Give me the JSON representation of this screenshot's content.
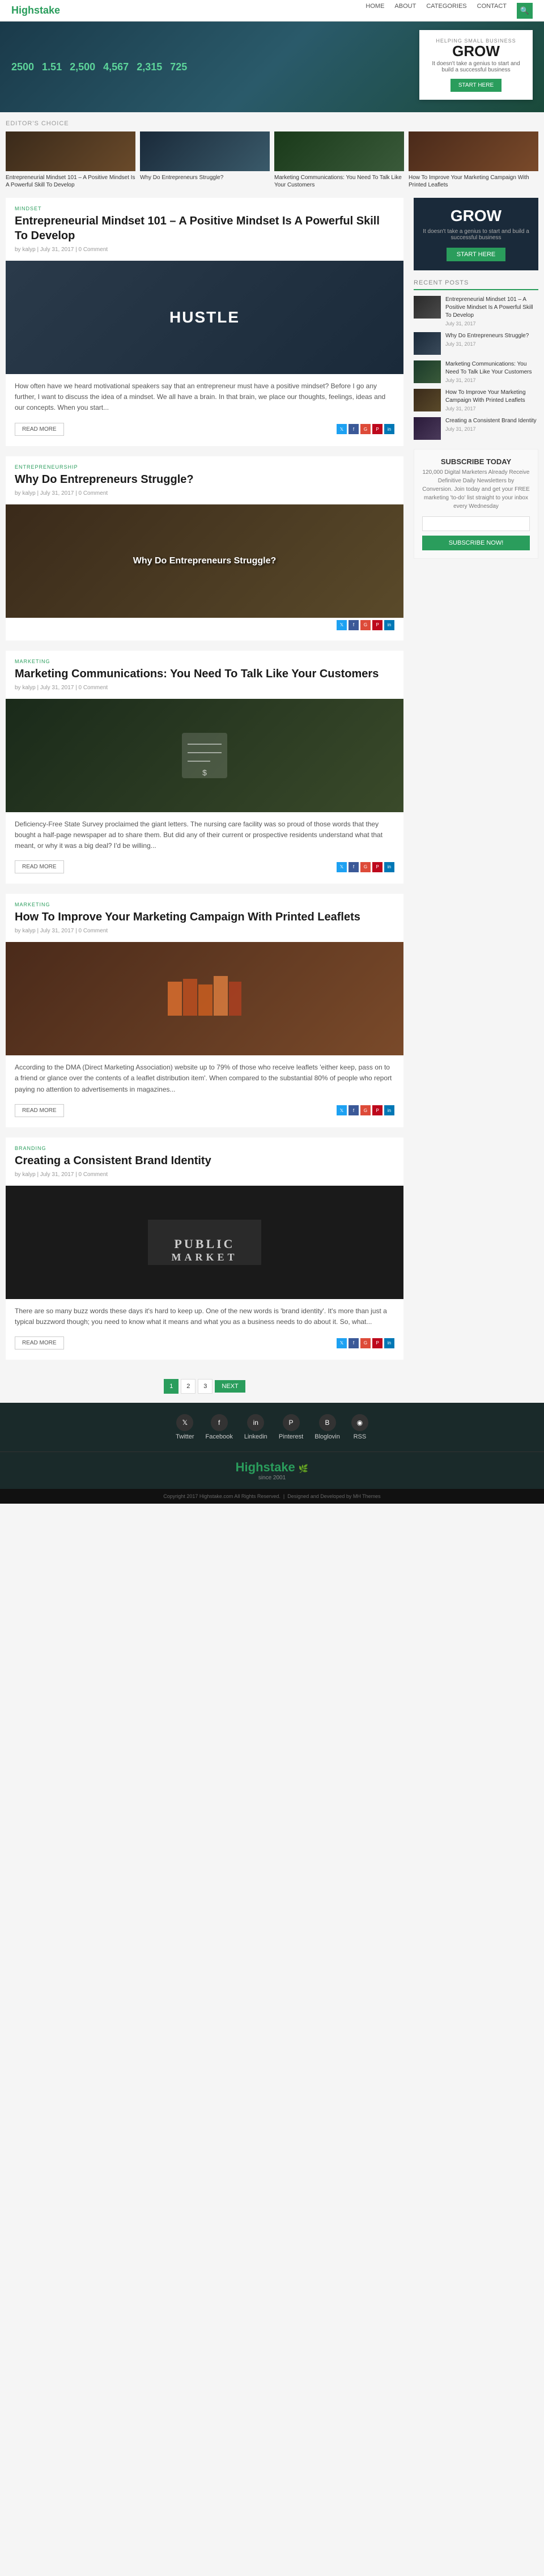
{
  "nav": {
    "brand": "Highstake",
    "links": [
      "Home",
      "About",
      "Categories",
      "Contact"
    ],
    "search_placeholder": "Search..."
  },
  "hero": {
    "stats": [
      {
        "label": "",
        "value": "2500"
      },
      {
        "label": "",
        "value": "1.51"
      },
      {
        "label": "",
        "value": "2,500"
      },
      {
        "label": "",
        "value": "4,567"
      },
      {
        "label": "",
        "value": "2,315"
      },
      {
        "label": "",
        "value": "725"
      }
    ],
    "cta": {
      "small": "HELPING SMALL BUSINESS",
      "title": "GROW",
      "sub": "It doesn't take a genius to start and build a successful business",
      "btn": "START HERE"
    }
  },
  "editors_choice": {
    "label": "EDITOR'S CHOICE",
    "cards": [
      {
        "id": "card-1",
        "title": "Entrepreneurial Mindset 101 – A Positive Mindset Is A Powerful Skill To Develop",
        "thumb_class": "thumb-1"
      },
      {
        "id": "card-2",
        "title": "Why Do Entrepreneurs Struggle?",
        "thumb_class": "thumb-2"
      },
      {
        "id": "card-3",
        "title": "Marketing Communications: You Need To Talk Like Your Customers",
        "thumb_class": "thumb-3"
      },
      {
        "id": "card-4",
        "title": "How To Improve Your Marketing Campaign With Printed Leaflets",
        "thumb_class": "thumb-4"
      }
    ]
  },
  "posts": [
    {
      "id": "post-1",
      "category": "MINDSET",
      "title": "Entrepreneurial Mindset 101 – A Positive Mindset Is A Powerful Skill To Develop",
      "meta": "by kalyp   |   July 31, 2017   |   0 Comment",
      "image_class": "hustle",
      "image_label": "HUSTLE",
      "excerpt": "How often have we heard motivational speakers say that an entrepreneur must have a positive mindset? Before I go any further, I want to discuss the idea of a mindset. We all have a brain. In that brain, we place our thoughts, feelings, ideas and our concepts. When you start...",
      "read_more": "READ MORE"
    },
    {
      "id": "post-2",
      "category": "ENTREPRENEURSHIP",
      "title": "Why Do Entrepreneurs Struggle?",
      "meta": "by kalyp   |   July 31, 2017   |   0 Comment",
      "image_class": "struggle",
      "image_label": "Why Do Entrepreneurs Struggle?",
      "excerpt": "",
      "read_more": ""
    },
    {
      "id": "post-3",
      "category": "MARKETING",
      "title": "Marketing Communications: You Need To Talk Like Your Customers",
      "meta": "by kalyp   |   July 31, 2017   |   0 Comment",
      "image_class": "marketing",
      "image_label": "",
      "excerpt": "Deficiency-Free State Survey proclaimed the giant letters. The nursing care facility was so proud of those words that they bought a half-page newspaper ad to share them. But did any of their current or prospective residents understand what that meant, or why it was a big deal? I'd be willing...",
      "read_more": "READ MORE"
    },
    {
      "id": "post-4",
      "category": "MARKETING",
      "title": "How To Improve Your Marketing Campaign With Printed Leaflets",
      "meta": "by kalyp   |   July 31, 2017   |   0 Comment",
      "image_class": "leaflets",
      "image_label": "",
      "excerpt": "According to the DMA (Direct Marketing Association) website up to 79% of those who receive leaflets 'either keep, pass on to a friend or glance over the contents of a leaflet distribution item'. When compared to the substantial 80% of people who report paying no attention to advertisements in magazines...",
      "read_more": "READ MORE"
    },
    {
      "id": "post-5",
      "category": "BRANDING",
      "title": "Creating a Consistent Brand Identity",
      "meta": "by kalyp   |   July 31, 2017   |   0 Comment",
      "image_class": "brand",
      "image_label": "PUBLIC MARKET",
      "excerpt": "There are so many buzz words these days it's hard to keep up. One of the new words is 'brand identity'. It's more than just a typical buzzword though; you need to know what it means and what you as a business needs to do about it. So, what...",
      "read_more": "READ MORE"
    }
  ],
  "sidebar": {
    "grow_box": {
      "title": "GROW",
      "sub": "It doesn't take a genius to start and build a successful business",
      "btn": "START HERE"
    },
    "recent_posts": {
      "label": "RECENT POSTS",
      "items": [
        {
          "title": "Entrepreneurial Mindset 101 – A Positive Mindset Is A Powerful Skill To Develop",
          "date": "July 31, 2017",
          "thumb_class": "rt-1"
        },
        {
          "title": "Why Do Entrepreneurs Struggle?",
          "date": "July 31, 2017",
          "thumb_class": "rt-2"
        },
        {
          "title": "Marketing Communications: You Need To Talk Like Your Customers",
          "date": "July 31, 2017",
          "thumb_class": "rt-3"
        },
        {
          "title": "How To Improve Your Marketing Campaign With Printed Leaflets",
          "date": "July 31, 2017",
          "thumb_class": "rt-4"
        },
        {
          "title": "Creating a Consistent Brand Identity",
          "date": "July 31, 2017",
          "thumb_class": "rt-5"
        }
      ]
    },
    "subscribe": {
      "title": "SUBSCRIBE TODAY",
      "sub": "120,000 Digital Marketers Already Receive Definitive Daily Newsletters by Conversion. Join today and get your FREE marketing 'to-do' list straight to your inbox every Wednesday",
      "input_placeholder": "",
      "btn": "SUBSCRIBE NOW!"
    }
  },
  "pagination": {
    "pages": [
      "1",
      "2",
      "3"
    ],
    "active": "1",
    "next": "NEXT"
  },
  "footer": {
    "social_links": [
      {
        "label": "Twitter",
        "icon": "𝕏"
      },
      {
        "label": "Facebook",
        "icon": "f"
      },
      {
        "label": "Linkedin",
        "icon": "in"
      },
      {
        "label": "Pinterest",
        "icon": "P"
      },
      {
        "label": "Bloglovin",
        "icon": "B"
      },
      {
        "label": "RSS",
        "icon": "◉"
      }
    ],
    "brand": "Highstake",
    "since": "since 2001",
    "copyright": "Copyright 2017 Highstake.com All Rights Reserved.",
    "designed": "Designed and Developed by MH Themes"
  }
}
